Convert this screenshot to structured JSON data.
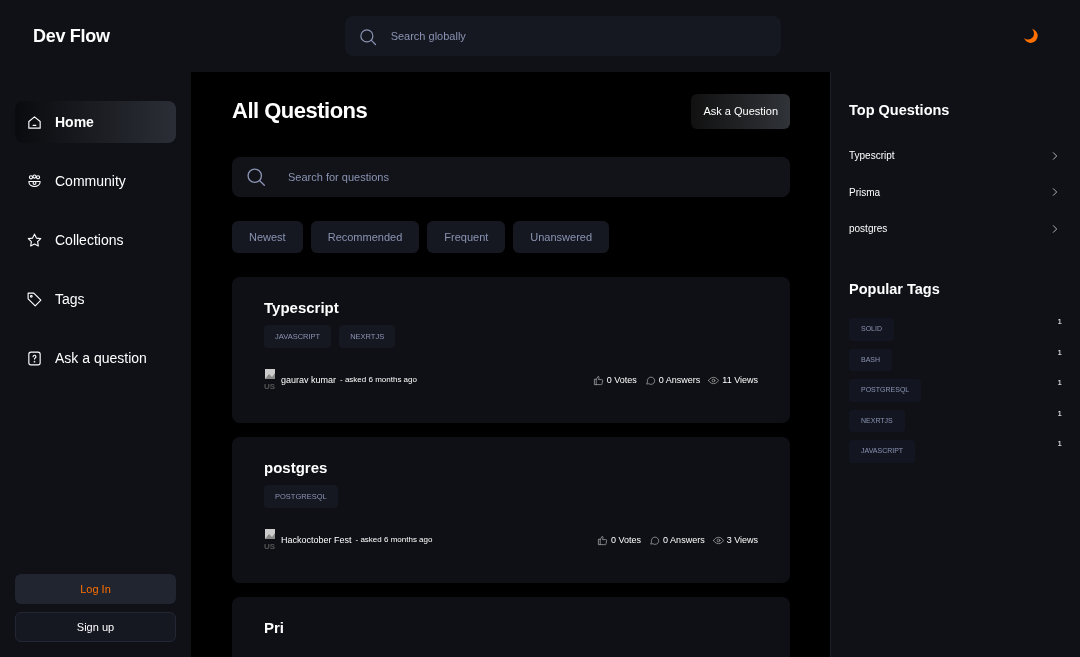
{
  "logo": "Dev Flow",
  "global_search": {
    "placeholder": "Search globally"
  },
  "nav": [
    {
      "label": "Home",
      "kind": "home",
      "selected": true
    },
    {
      "label": "Community",
      "kind": "community",
      "selected": false
    },
    {
      "label": "Collections",
      "kind": "star",
      "selected": false
    },
    {
      "label": "Tags",
      "kind": "tag",
      "selected": false
    },
    {
      "label": "Ask a question",
      "kind": "question",
      "selected": false
    }
  ],
  "auth_buttons": [
    {
      "label": "Log In",
      "kind": "primary"
    },
    {
      "label": "Sign up",
      "kind": "secondary"
    }
  ],
  "page_title": "All Questions",
  "ask_button": "Ask a Question",
  "question_search": {
    "placeholder": "Search for questions"
  },
  "filters": [
    {
      "label": "Newest",
      "selected": false
    },
    {
      "label": "Recommended",
      "selected": false
    },
    {
      "label": "Frequent",
      "selected": false
    },
    {
      "label": "Unanswered",
      "selected": false
    }
  ],
  "questions": [
    {
      "title": "Typescript",
      "tags": [
        "JAVASCRIPT",
        "NEXRTJS"
      ],
      "avatar_alt": "US",
      "author": "gaurav kumar",
      "asked": "- asked 6 months ago",
      "votes": "0 Votes",
      "answers": "0 Answers",
      "views": "11 Views"
    },
    {
      "title": "postgres",
      "tags": [
        "POSTGRESQL"
      ],
      "avatar_alt": "US",
      "author": "Hackoctober Fest",
      "asked": "- asked 6 months ago",
      "votes": "0 Votes",
      "answers": "0 Answers",
      "views": "3 Views"
    },
    {
      "title": "Pri"
    }
  ],
  "top_questions": {
    "title": "Top Questions",
    "items": [
      "Typescript",
      "Prisma",
      "postgres"
    ]
  },
  "popular_tags": {
    "title": "Popular Tags",
    "items": [
      {
        "name": "SOLID",
        "count": "1"
      },
      {
        "name": "BASH",
        "count": "1"
      },
      {
        "name": "POSTGRESQL",
        "count": "1"
      },
      {
        "name": "NEXRTJS",
        "count": "1"
      },
      {
        "name": "JAVASCRIPT",
        "count": "1"
      }
    ]
  }
}
